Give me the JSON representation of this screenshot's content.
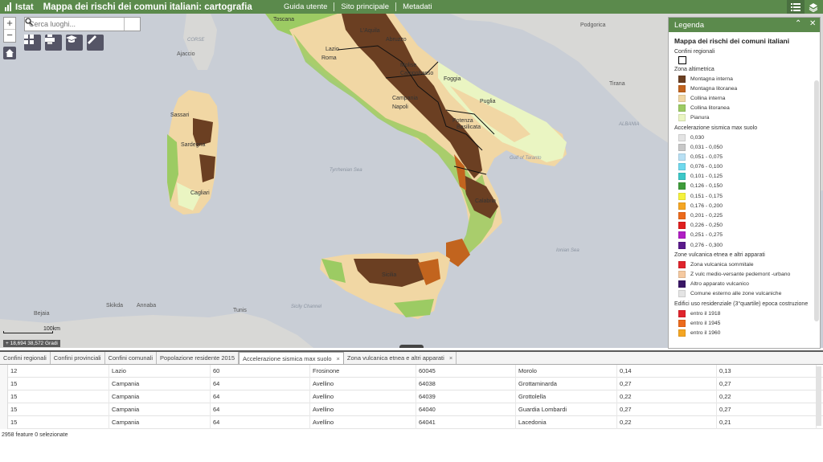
{
  "header": {
    "logo_text": "Istat",
    "title": "Mappa dei rischi dei comuni italiani: cartografia",
    "nav": [
      "Guida utente",
      "Sito principale",
      "Metadati"
    ],
    "buttons": [
      "legend-list-icon",
      "layers-icon"
    ]
  },
  "map": {
    "search_placeholder": "Cerca luoghi...",
    "zoom_in": "+",
    "zoom_out": "−",
    "scale_label": "100km",
    "coords": "18,694 38,572 Gradi",
    "labels": {
      "toscana": "Toscana",
      "laquila": "L'Aquila",
      "abruzzo": "Abruzzo",
      "lazio": "Lazio",
      "roma": "Roma",
      "molise": "Molise",
      "campobasso": "Campobasso",
      "foggia": "Foggia",
      "puglia": "Puglia",
      "campania": "Campania",
      "napoli": "Napoli",
      "potenza": "Potenza",
      "basilicata": "Basilicata",
      "calabria": "Calabria",
      "sicilia": "Sicilia",
      "sardegna": "Sardegna",
      "sassari": "Sassari",
      "cagliari": "Cagliari",
      "ajaccio": "Ajaccio",
      "corse": "CORSE",
      "podgorica": "Podgorica",
      "tirana": "Tirana",
      "albania": "ALBANIA",
      "bejaia": "Bejaia",
      "skikda": "Skikda",
      "annaba": "Annaba",
      "tunis": "Tunis",
      "tyrrhenian": "Tyrrhenian Sea",
      "taranto_gulf": "Gulf of Taranto",
      "ionian": "Ionian Sea",
      "sicily_channel": "Sicily Channel"
    }
  },
  "legend": {
    "header": "Legenda",
    "title": "Mappa dei rischi dei comuni italiani",
    "sections": [
      {
        "name": "Confini regionali",
        "outline": true,
        "items": []
      },
      {
        "name": "Zona altimetrica",
        "items": [
          {
            "label": "Montagna interna",
            "color": "#6b3f22"
          },
          {
            "label": "Montagna litoranea",
            "color": "#c2641e"
          },
          {
            "label": "Collina interna",
            "color": "#f1d7a4"
          },
          {
            "label": "Collina litoranea",
            "color": "#9ccb63"
          },
          {
            "label": "Pianura",
            "color": "#eaf5c2"
          }
        ]
      },
      {
        "name": "Accelerazione sismica max suolo",
        "items": [
          {
            "label": "0,030",
            "color": "#e4e4e4"
          },
          {
            "label": "0,031 - 0,050",
            "color": "#c8c8c8"
          },
          {
            "label": "0,051 - 0,075",
            "color": "#b8e0f4"
          },
          {
            "label": "0,076 - 0,100",
            "color": "#6fd9ee"
          },
          {
            "label": "0,101 - 0,125",
            "color": "#3cc8c8"
          },
          {
            "label": "0,126 - 0,150",
            "color": "#3e9c3a"
          },
          {
            "label": "0,151 - 0,175",
            "color": "#f5f23c"
          },
          {
            "label": "0,176 - 0,200",
            "color": "#f5a623"
          },
          {
            "label": "0,201 - 0,225",
            "color": "#ec6a1c"
          },
          {
            "label": "0,226 - 0,250",
            "color": "#e01f1f"
          },
          {
            "label": "0,251 - 0,275",
            "color": "#b01ec4"
          },
          {
            "label": "0,276 - 0,300",
            "color": "#5b1b8c"
          }
        ]
      },
      {
        "name": "Zone vulcanica etnea e altri apparati",
        "items": [
          {
            "label": "Zona vulcanica sommitale",
            "color": "#e0242c"
          },
          {
            "label": "Z vulc medio-versante pedemont -urbano",
            "color": "#f5c9a0"
          },
          {
            "label": "Altro apparato vulcanico",
            "color": "#3a1766"
          },
          {
            "label": "Comune esterno alle zone vulcaniche",
            "color": "#e4e4e4"
          }
        ]
      },
      {
        "name": "Edifici uso residenziale (3°quartile) epoca costruzione",
        "items": [
          {
            "label": "entro il 1918",
            "color": "#e0242c"
          },
          {
            "label": "entro il 1945",
            "color": "#ec6a1c"
          },
          {
            "label": "entro il 1960",
            "color": "#f5a623"
          }
        ]
      }
    ]
  },
  "table": {
    "tabs": [
      "Confini regionali",
      "Confini provinciali",
      "Confini comunali",
      "Popolazione residente 2015",
      "Accelerazione sismica max suolo",
      "Zona vulcanica etnea e altri apparati"
    ],
    "active_tab": 4,
    "rows": [
      [
        "12",
        "Lazio",
        "60",
        "Frosinone",
        "60045",
        "Morolo",
        "0,14",
        "0,13"
      ],
      [
        "15",
        "Campania",
        "64",
        "Avellino",
        "64038",
        "Grottaminarda",
        "0,27",
        "0,27"
      ],
      [
        "15",
        "Campania",
        "64",
        "Avellino",
        "64039",
        "Grottolella",
        "0,22",
        "0,22"
      ],
      [
        "15",
        "Campania",
        "64",
        "Avellino",
        "64040",
        "Guardia Lombardi",
        "0,27",
        "0,27"
      ],
      [
        "15",
        "Campania",
        "64",
        "Avellino",
        "64041",
        "Lacedonia",
        "0,22",
        "0,21"
      ]
    ],
    "footer": "2958 feature 0 selezionate"
  }
}
